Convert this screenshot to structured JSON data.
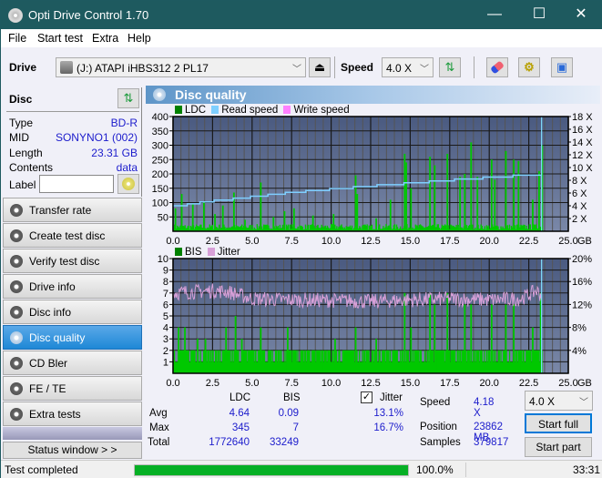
{
  "window": {
    "title": "Opti Drive Control 1.70",
    "minimize": "—",
    "maximize": "☐",
    "close": "✕"
  },
  "menu": [
    "File",
    "Start test",
    "Extra",
    "Help"
  ],
  "toolbar": {
    "drive_label": "Drive",
    "drive_value": "(J:)  ATAPI iHBS312  2 PL17",
    "speed_label": "Speed",
    "speed_value": "4.0 X"
  },
  "disc": {
    "header": "Disc",
    "rows": [
      {
        "label": "Type",
        "value": "BD-R"
      },
      {
        "label": "MID",
        "value": "SONYNO1 (002)"
      },
      {
        "label": "Length",
        "value": "23.31 GB"
      },
      {
        "label": "Contents",
        "value": "data"
      }
    ],
    "label_field_label": "Label",
    "label_field_value": ""
  },
  "nav": [
    {
      "label": "Transfer rate",
      "active": false
    },
    {
      "label": "Create test disc",
      "active": false
    },
    {
      "label": "Verify test disc",
      "active": false
    },
    {
      "label": "Drive info",
      "active": false
    },
    {
      "label": "Disc info",
      "active": false
    },
    {
      "label": "Disc quality",
      "active": true
    },
    {
      "label": "CD Bler",
      "active": false
    },
    {
      "label": "FE / TE",
      "active": false
    },
    {
      "label": "Extra tests",
      "active": false
    }
  ],
  "status_window_btn": "Status window > >",
  "panel_title": "Disc quality",
  "colors": {
    "ldc": "#00c800",
    "read_speed": "#7fcfff",
    "write_speed": "#ff80ff",
    "bis": "#00c800",
    "jitter": "#d8a0d8",
    "plot_bg_top": "#4a5a80",
    "plot_bg_bottom": "#7a88a8",
    "progress": "#06b025"
  },
  "chart_data": [
    {
      "type": "bar",
      "title": "LDC / Read speed",
      "legend": [
        "LDC",
        "Read speed",
        "Write speed"
      ],
      "xlabel": "GB",
      "x_ticks": [
        "0.0",
        "2.5",
        "5.0",
        "7.5",
        "10.0",
        "12.5",
        "15.0",
        "17.5",
        "20.0",
        "22.5",
        "25.0"
      ],
      "xlim": [
        0,
        25
      ],
      "y_left_ticks": [
        "50",
        "100",
        "150",
        "200",
        "250",
        "300",
        "350",
        "400"
      ],
      "ylim_left": [
        0,
        400
      ],
      "y_right_ticks": [
        "2 X",
        "4 X",
        "6 X",
        "8 X",
        "10 X",
        "12 X",
        "14 X",
        "16 X",
        "18 X"
      ],
      "ylim_right": [
        0,
        18
      ],
      "end_marker_gb": 23.31,
      "ldc_peaks": [
        [
          0.1,
          80
        ],
        [
          0.5,
          130
        ],
        [
          1.2,
          95
        ],
        [
          1.9,
          100
        ],
        [
          2.6,
          60
        ],
        [
          3.1,
          90
        ],
        [
          3.8,
          135
        ],
        [
          4.5,
          40
        ],
        [
          5.5,
          170
        ],
        [
          6.3,
          50
        ],
        [
          7.0,
          70
        ],
        [
          7.6,
          80
        ],
        [
          8.8,
          55
        ],
        [
          10.1,
          60
        ],
        [
          11.5,
          195
        ],
        [
          11.6,
          130
        ],
        [
          12.8,
          45
        ],
        [
          13.7,
          110
        ],
        [
          14.6,
          270
        ],
        [
          14.7,
          240
        ],
        [
          15.0,
          150
        ],
        [
          16.2,
          260
        ],
        [
          16.5,
          230
        ],
        [
          17.3,
          270
        ],
        [
          18.1,
          190
        ],
        [
          18.4,
          200
        ],
        [
          18.8,
          310
        ],
        [
          19.2,
          190
        ],
        [
          20.1,
          250
        ],
        [
          20.3,
          180
        ],
        [
          21.0,
          280
        ],
        [
          21.5,
          250
        ],
        [
          21.8,
          245
        ],
        [
          22.7,
          110
        ],
        [
          23.1,
          210
        ],
        [
          23.3,
          300
        ]
      ],
      "read_speed": [
        [
          0,
          4.0
        ],
        [
          0.9,
          4.3
        ],
        [
          1.7,
          4.6
        ],
        [
          2.6,
          4.9
        ],
        [
          3.8,
          5.2
        ],
        [
          4.9,
          5.5
        ],
        [
          6.0,
          5.8
        ],
        [
          7.1,
          6.1
        ],
        [
          8.4,
          6.4
        ],
        [
          9.9,
          6.7
        ],
        [
          11.4,
          7.0
        ],
        [
          12.9,
          7.3
        ],
        [
          14.6,
          7.6
        ],
        [
          16.2,
          7.9
        ],
        [
          17.8,
          8.2
        ],
        [
          19.6,
          8.5
        ],
        [
          21.5,
          8.8
        ],
        [
          23.31,
          8.8
        ]
      ]
    },
    {
      "type": "bar",
      "title": "BIS / Jitter",
      "legend": [
        "BIS",
        "Jitter"
      ],
      "xlabel": "GB",
      "x_ticks": [
        "0.0",
        "2.5",
        "5.0",
        "7.5",
        "10.0",
        "12.5",
        "15.0",
        "17.5",
        "20.0",
        "22.5",
        "25.0"
      ],
      "xlim": [
        0,
        25
      ],
      "y_left_ticks": [
        "1",
        "2",
        "3",
        "4",
        "5",
        "6",
        "7",
        "8",
        "9",
        "10"
      ],
      "ylim_left": [
        0,
        10
      ],
      "y_right_ticks": [
        "4%",
        "8%",
        "12%",
        "16%",
        "20%"
      ],
      "ylim_right": [
        0,
        20
      ],
      "end_marker_gb": 23.31,
      "bis_base": 2,
      "bis_peaks": [
        [
          0.3,
          4
        ],
        [
          0.7,
          4
        ],
        [
          1.5,
          3
        ],
        [
          2.0,
          3
        ],
        [
          3.3,
          4
        ],
        [
          3.9,
          5
        ],
        [
          4.3,
          3
        ],
        [
          5.5,
          4
        ],
        [
          7.2,
          4
        ],
        [
          10.2,
          3
        ],
        [
          11.5,
          4
        ],
        [
          12.8,
          3
        ],
        [
          14.6,
          7
        ],
        [
          15.0,
          4
        ],
        [
          16.2,
          7
        ],
        [
          16.5,
          6
        ],
        [
          17.3,
          7
        ],
        [
          18.4,
          6
        ],
        [
          18.8,
          6
        ],
        [
          20.1,
          6
        ],
        [
          21.0,
          6
        ],
        [
          21.5,
          6
        ],
        [
          22.7,
          4
        ],
        [
          23.2,
          7
        ]
      ],
      "jitter_profile": [
        [
          0,
          14.0
        ],
        [
          2.5,
          14.4
        ],
        [
          3.5,
          14.2
        ],
        [
          5.0,
          13.0
        ],
        [
          7.5,
          12.8
        ],
        [
          10.0,
          12.7
        ],
        [
          12.5,
          12.5
        ],
        [
          15.0,
          12.8
        ],
        [
          17.5,
          13.0
        ],
        [
          20.0,
          12.8
        ],
        [
          22.0,
          13.0
        ],
        [
          23.0,
          14.4
        ],
        [
          23.31,
          13.5
        ]
      ]
    }
  ],
  "stats": {
    "col_ldc": "LDC",
    "col_bis": "BIS",
    "jitter_label": "Jitter",
    "jitter_checked": true,
    "rows": [
      {
        "label": "Avg",
        "ldc": "4.64",
        "bis": "0.09",
        "jitter": "13.1%"
      },
      {
        "label": "Max",
        "ldc": "345",
        "bis": "7",
        "jitter": "16.7%"
      },
      {
        "label": "Total",
        "ldc": "1772640",
        "bis": "33249",
        "jitter": ""
      }
    ],
    "speed_label": "Speed",
    "speed_value": "4.18 X",
    "position_label": "Position",
    "position_value": "23862 MB",
    "samples_label": "Samples",
    "samples_value": "379817",
    "speed_select": "4.0 X",
    "start_full": "Start full",
    "start_part": "Start part"
  },
  "statusbar": {
    "text": "Test completed",
    "progress": 100.0,
    "progress_text": "100.0%",
    "time": "33:31"
  }
}
